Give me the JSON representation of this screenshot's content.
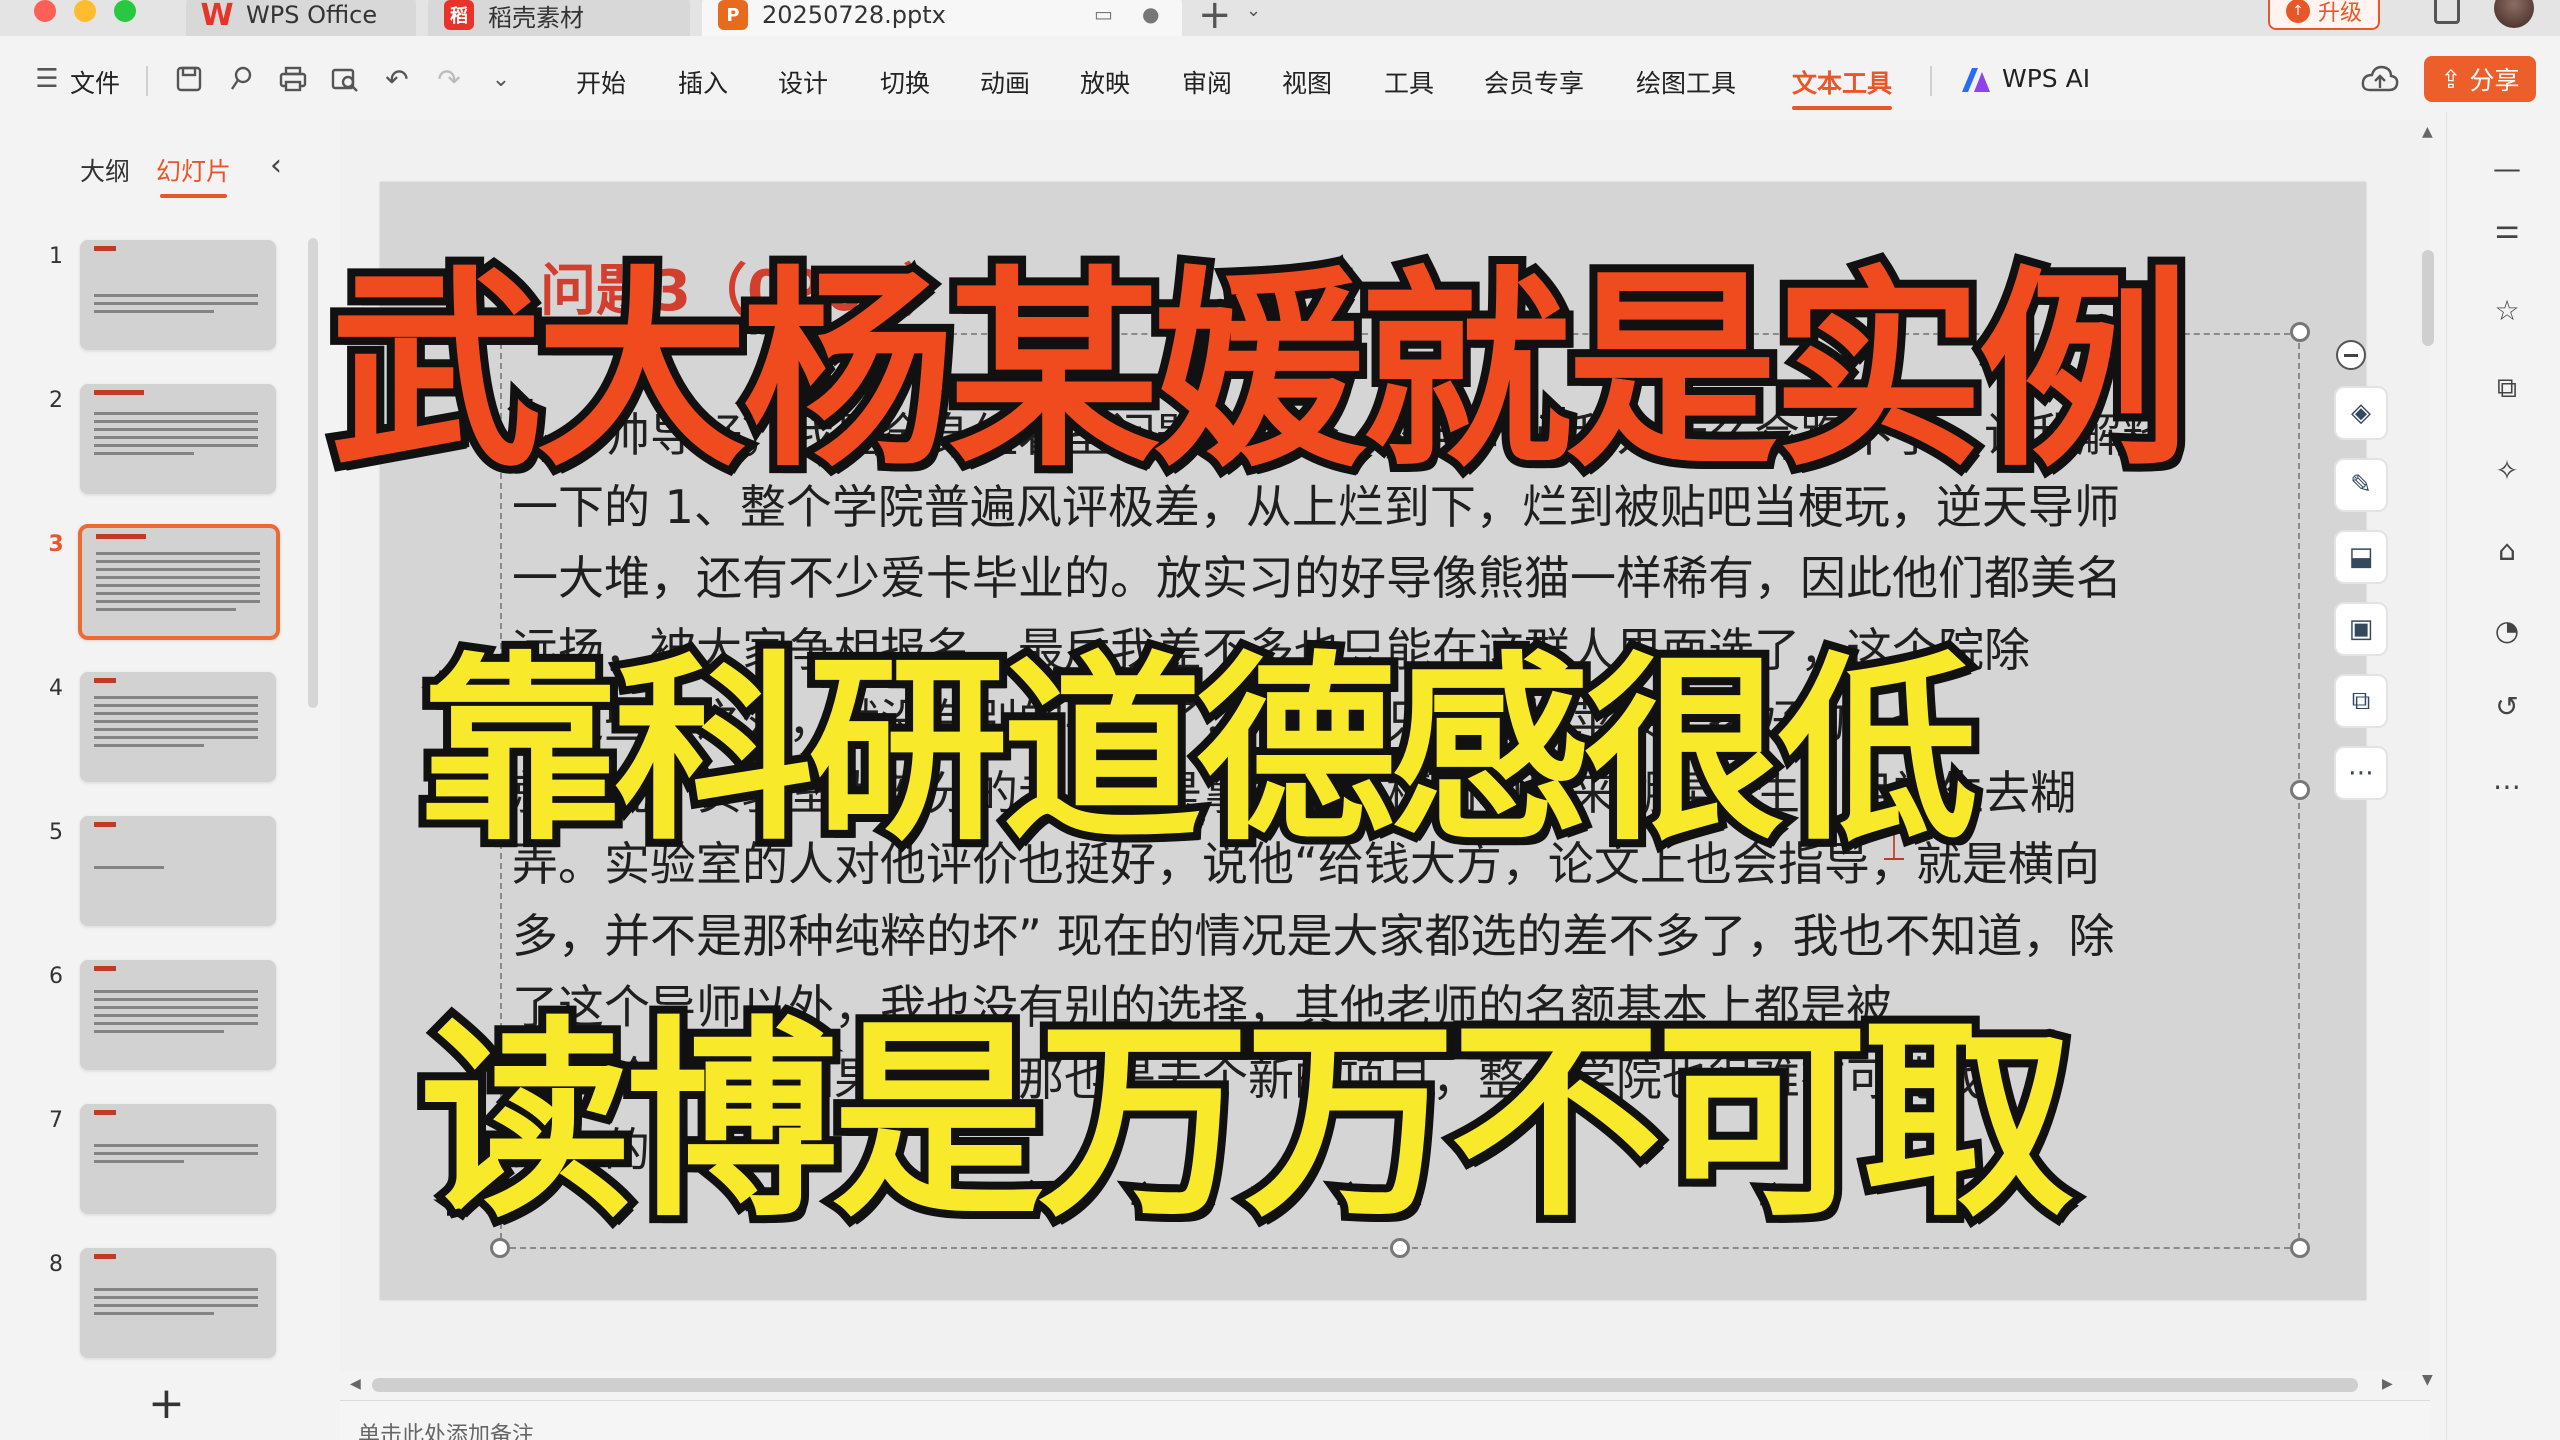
{
  "titlebar": {
    "tabs": [
      {
        "label": "WPS Office"
      },
      {
        "label": "稻壳素材"
      },
      {
        "label": "20250728.pptx"
      }
    ],
    "upgrade_label": "升级"
  },
  "menu": {
    "file": "文件",
    "items": [
      "开始",
      "插入",
      "设计",
      "切换",
      "动画",
      "放映",
      "审阅",
      "视图",
      "工具",
      "会员专享",
      "绘图工具",
      "文本工具"
    ],
    "active": "文本工具",
    "wps_ai": "WPS AI",
    "share": "分享"
  },
  "left_panel": {
    "tabs": [
      "大纲",
      "幻灯片"
    ],
    "active_tab": "幻灯片",
    "slide_numbers": [
      "1",
      "2",
      "3",
      "4",
      "5",
      "6",
      "7",
      "8"
    ],
    "selected_slide": "3"
  },
  "slide": {
    "title_hint": "问题3（0900）",
    "body_lines": [
      "帅导好，我是全身组着室问题的那个，您当时问我为什么会跑不了，让我解释",
      "一下的 1、整个学院普遍风评极差，从上烂到下，烂到被贴吧当梗玩，逆天导师",
      "一大堆，还有不少爱卡毕业的。放实习的好导像熊猫一样稀有，因此他们都美名",
      "远扬，被大家争相报名，最后我差不多也只能在这群人里面选了，这个院除",
      "了这些人之外，就没有别的导师了，所以也只能在烂苹果里挑好的，也",
      "就是说，实验室大部分的老师都是拿着很多横向项目来糊弄学生，用学生去糊",
      "弄。实验室的人对他评价也挺好，说他“给钱大方，论文上也会指导，就是横向",
      "多，并不是那种纯粹的坏” 现在的情况是大家都选的差不多了，我也不知道，除",
      "了这个导师以外，我也没有别的选择，其他老师的名额基本上都是被",
      "别人抢走了，如果要选，那也是去个新的项目，整个学院也很难有可能找",
      "到好的"
    ]
  },
  "captions": {
    "line1": "武大杨某媛就是实例",
    "line2": "靠科研道德感很低",
    "line3": "读博是万万不可取"
  },
  "notes_placeholder": "单击此处添加备注",
  "icons": {
    "float_toolbar": [
      "layers-icon",
      "brush-icon",
      "fill-icon",
      "frame-icon",
      "image-text-icon",
      "more-icon"
    ],
    "right_sidebar": [
      "collapse-icon",
      "adjust-icon",
      "star-icon",
      "slide-copy-icon",
      "magic-icon",
      "shirt-icon",
      "animation-icon",
      "history-icon",
      "more-icon"
    ]
  },
  "colors": {
    "accent": "#e8572a",
    "caption_red": "#f04b1e",
    "caption_yellow": "#f8ea2a"
  }
}
